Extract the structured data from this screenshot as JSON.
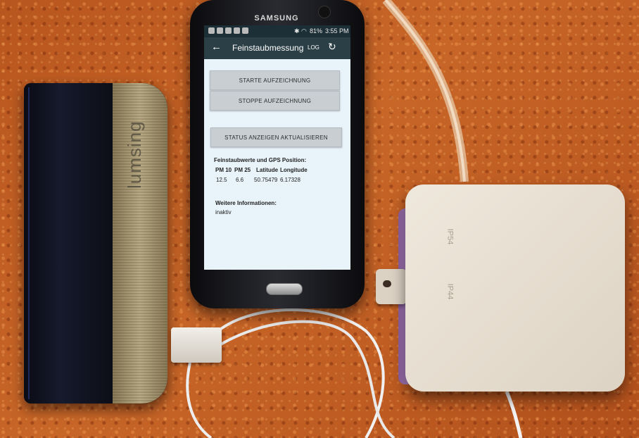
{
  "powerbank": {
    "brand_text": "lumsing"
  },
  "phone": {
    "brand_text": "SAMSUNG",
    "status_bar": {
      "battery": "81%",
      "time": "3:55 PM"
    },
    "app_bar": {
      "title": "Feinstaubmessung",
      "log_label": "LOG"
    },
    "buttons": {
      "start": "STARTE AUFZEICHNUNG",
      "stop": "STOPPE AUFZEICHNUNG",
      "status_refresh": "STATUS ANZEIGEN AKTUALISIEREN"
    },
    "readings": {
      "heading": "Feinstaubwerte und GPS Position:",
      "headers": [
        "PM 10",
        "PM 25",
        "Latitude",
        "Longitude"
      ],
      "values": [
        "12.5",
        "6.6",
        "50.75479",
        "6.17328"
      ]
    },
    "more_info": {
      "heading": "Weitere Informationen:",
      "value": "inaktiv"
    }
  },
  "sensor_box": {
    "embossed": [
      "IP54",
      "IP44"
    ]
  }
}
